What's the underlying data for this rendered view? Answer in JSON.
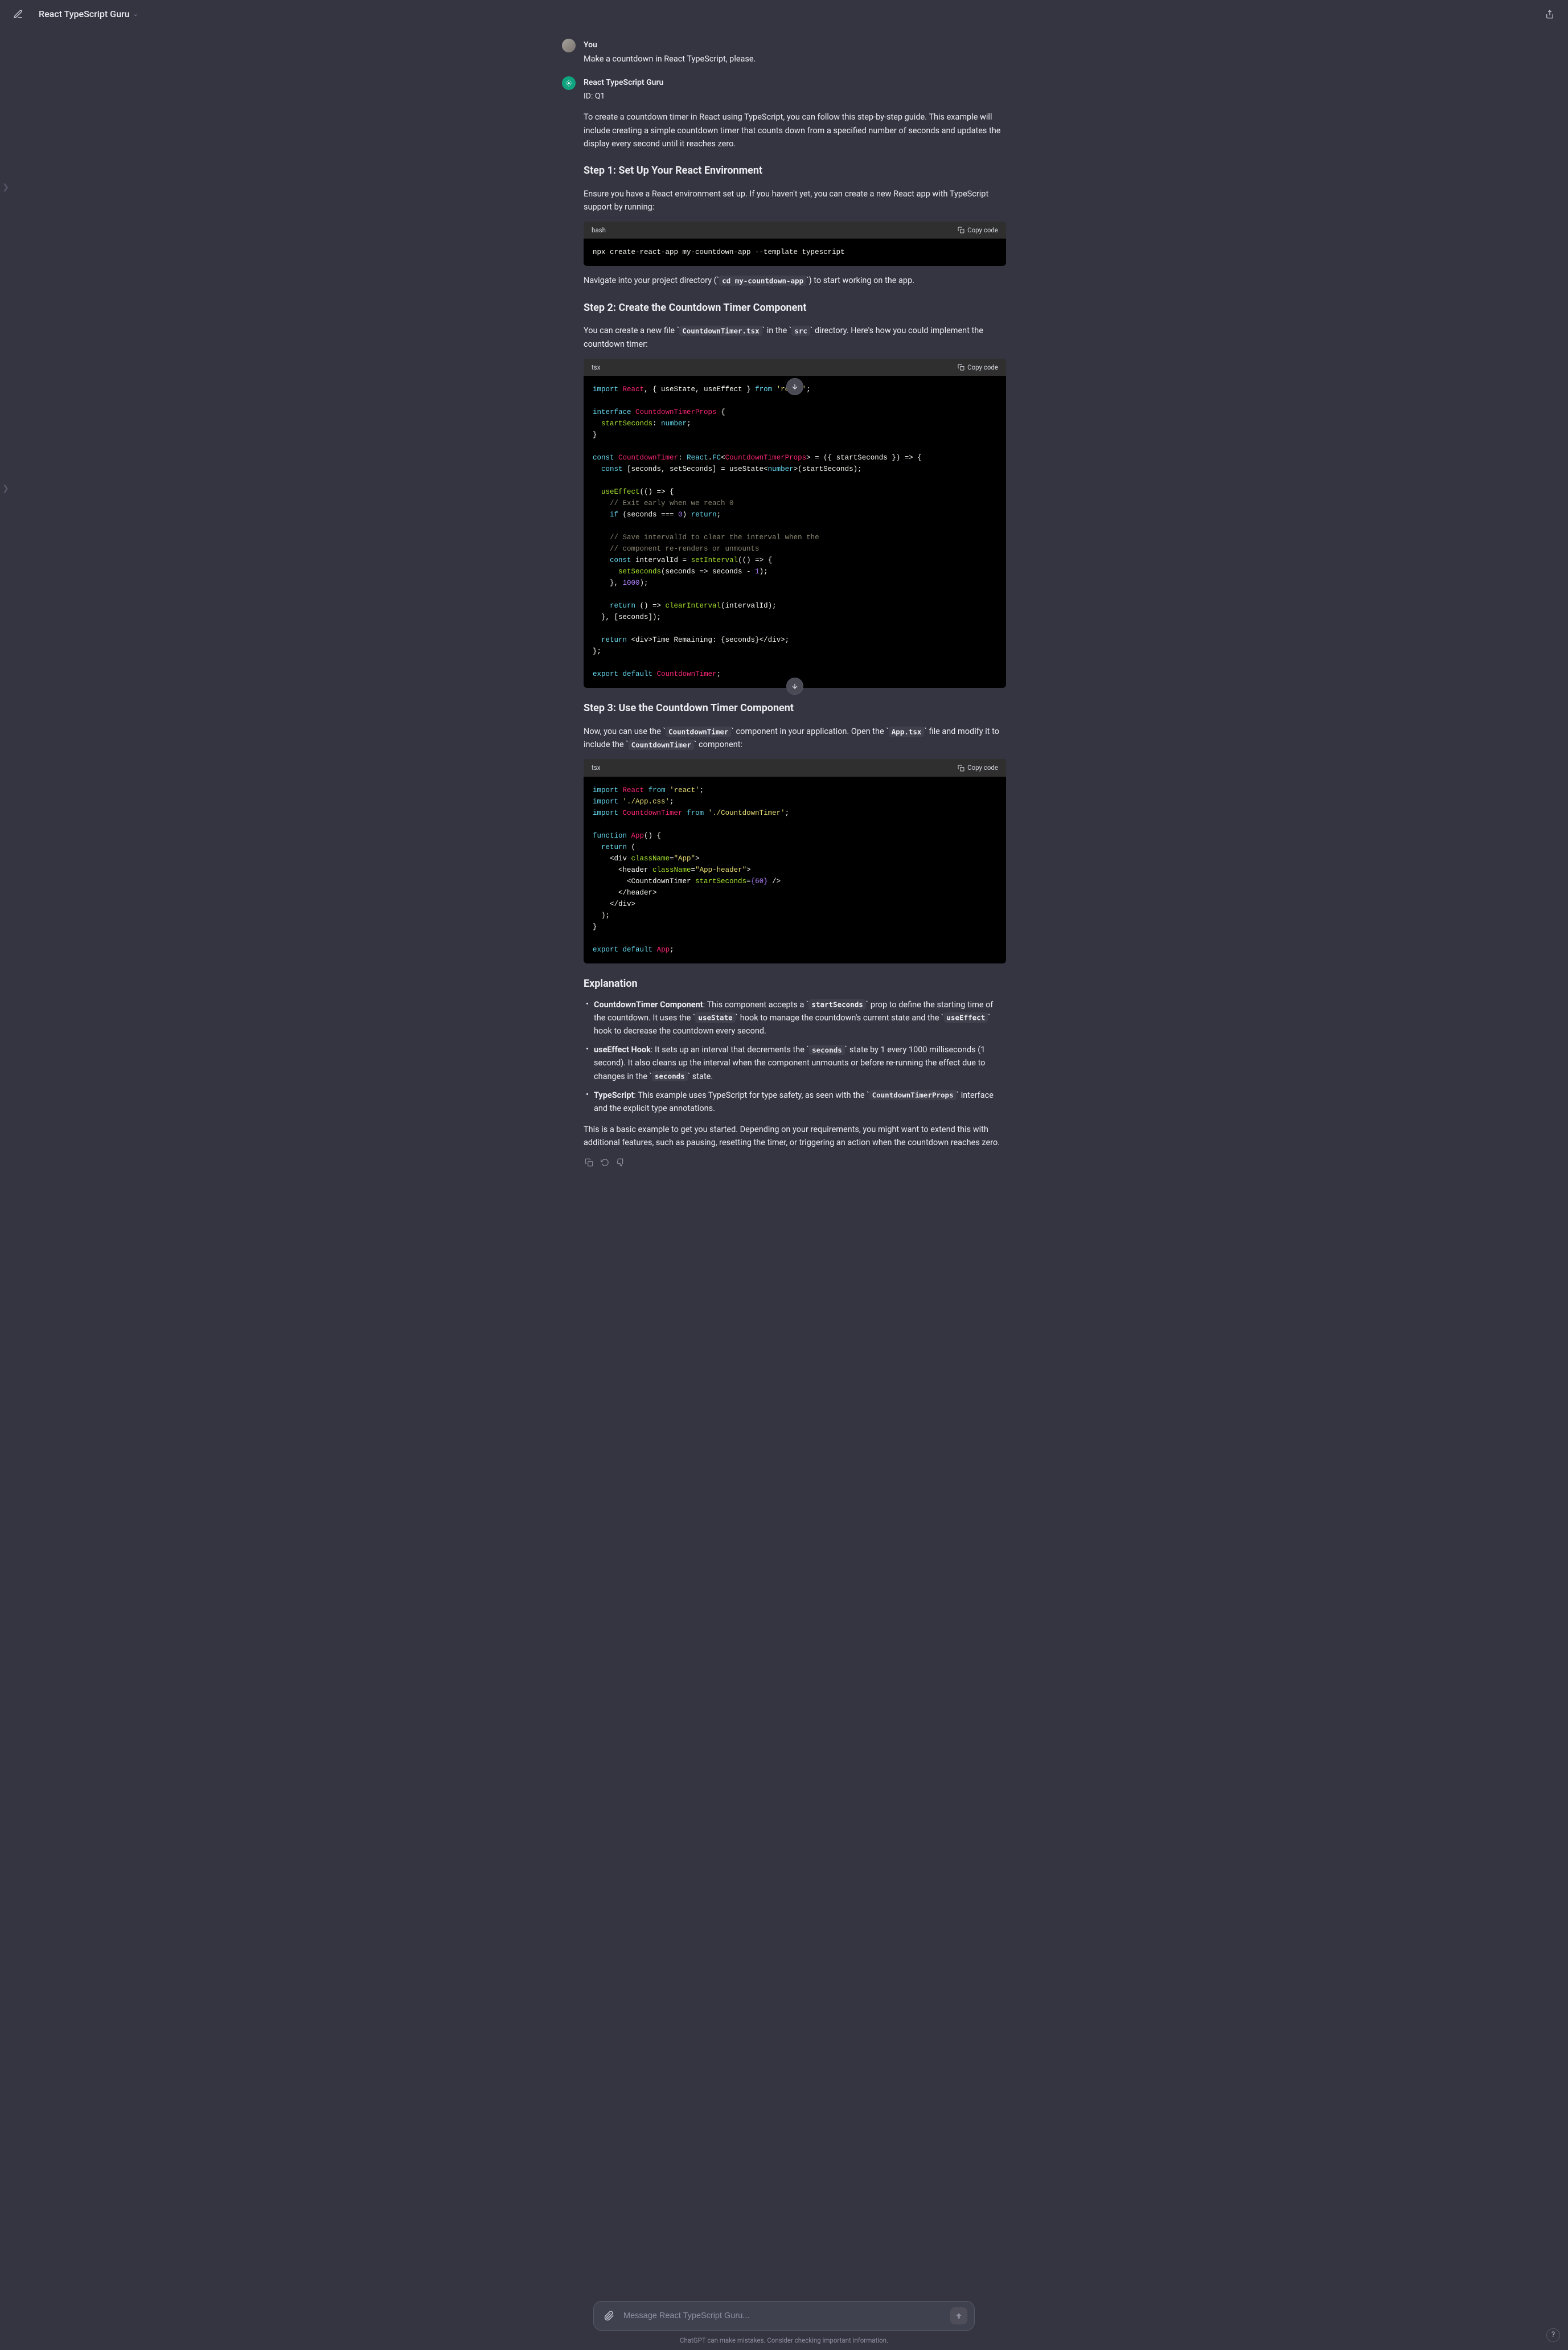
{
  "header": {
    "title": "React TypeScript Guru"
  },
  "user": {
    "author": "You",
    "text": "Make a countdown in React TypeScript, please."
  },
  "assistant": {
    "author": "React TypeScript Guru",
    "id": "ID: Q1",
    "intro": "To create a countdown timer in React using TypeScript, you can follow this step-by-step guide. This example will include creating a simple countdown timer that counts down from a specified number of seconds and updates the display every second until it reaches zero.",
    "step1": {
      "heading": "Step 1: Set Up Your React Environment",
      "desc": "Ensure you have a React environment set up. If you haven't yet, you can create a new React app with TypeScript support by running:",
      "code_lang": "bash",
      "copy": "Copy code",
      "nav_pre": "Navigate into your project directory (",
      "nav_code": "cd my-countdown-app",
      "nav_post": ") to start working on the app."
    },
    "step2": {
      "heading": "Step 2: Create the Countdown Timer Component",
      "desc_pre": "You can create a new file ",
      "desc_file": "CountdownTimer.tsx",
      "desc_mid": " in the ",
      "desc_src": "src",
      "desc_post": " directory. Here's how you could implement the countdown timer:",
      "code_lang": "tsx",
      "copy": "Copy code"
    },
    "step3": {
      "heading": "Step 3: Use the Countdown Timer Component",
      "desc_pre": "Now, you can use the ",
      "desc_c1": "CountdownTimer",
      "desc_mid1": " component in your application. Open the ",
      "desc_c2": "App.tsx",
      "desc_mid2": " file and modify it to include the ",
      "desc_c3": "CountdownTimer",
      "desc_post": " component:",
      "code_lang": "tsx",
      "copy": "Copy code"
    },
    "explanation": {
      "heading": "Explanation",
      "b1_strong": "CountdownTimer Component",
      "b1_t1": ": This component accepts a ",
      "b1_c1": "startSeconds",
      "b1_t2": " prop to define the starting time of the countdown. It uses the ",
      "b1_c2": "useState",
      "b1_t3": " hook to manage the countdown's current state and the ",
      "b1_c3": "useEffect",
      "b1_t4": " hook to decrease the countdown every second.",
      "b2_strong": "useEffect Hook",
      "b2_t1": ": It sets up an interval that decrements the ",
      "b2_c1": "seconds",
      "b2_t2": " state by 1 every 1000 milliseconds (1 second). It also cleans up the interval when the component unmounts or before re-running the effect due to changes in the ",
      "b2_c2": "seconds",
      "b2_t3": " state.",
      "b3_strong": "TypeScript",
      "b3_t1": ": This example uses TypeScript for type safety, as seen with the ",
      "b3_c1": "CountdownTimerProps",
      "b3_t2": " interface and the explicit type annotations."
    },
    "outro": "This is a basic example to get you started. Depending on your requirements, you might want to extend this with additional features, such as pausing, resetting the timer, or triggering an action when the countdown reaches zero."
  },
  "footer": {
    "placeholder": "Message React TypeScript Guru...",
    "disclaimer": "ChatGPT can make mistakes. Consider checking important information."
  },
  "help": "?"
}
